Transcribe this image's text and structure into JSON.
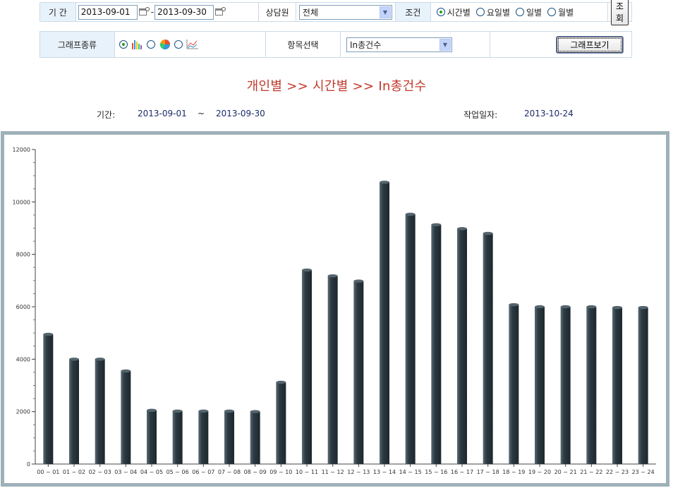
{
  "filter": {
    "period_label": "기 간",
    "start_date": "2013-09-01",
    "date_sep": "-",
    "end_date": "2013-09-30",
    "agent_label": "상담원",
    "agent_value": "전체",
    "condition_label": "조건",
    "conditions": [
      {
        "label": "시간별",
        "checked": true
      },
      {
        "label": "요일별",
        "checked": false
      },
      {
        "label": "일별",
        "checked": false
      },
      {
        "label": "월별",
        "checked": false
      }
    ],
    "search_button": "조회"
  },
  "graph_options": {
    "type_label": "그래프종류",
    "types": [
      {
        "icon": "bar-chart-icon",
        "checked": true
      },
      {
        "icon": "pie-chart-icon",
        "checked": false
      },
      {
        "icon": "line-chart-icon",
        "checked": false
      }
    ],
    "item_label": "항목선택",
    "item_value": "In총건수",
    "view_button": "그래프보기"
  },
  "report": {
    "heading": "개인별 >> 시간별 >> In총건수",
    "period_label": "기간:",
    "period_start": "2013-09-01",
    "period_tilde": "~",
    "period_end": "2013-09-30",
    "work_date_label": "작업일자:",
    "work_date": "2013-10-24"
  },
  "colors": {
    "bar": "#2c3a42",
    "bar_highlight": "#5b6b74",
    "title": "#c0392b",
    "frame": "#9eb0b8"
  },
  "chart_data": {
    "type": "bar",
    "title": "개인별 >> 시간별 >> In총건수",
    "xlabel": "",
    "ylabel": "",
    "ylim": [
      0,
      12000
    ],
    "yticks": [
      0,
      2000,
      4000,
      6000,
      8000,
      10000,
      12000
    ],
    "grid": false,
    "categories": [
      "00 ~ 01",
      "01 ~ 02",
      "02 ~ 03",
      "03 ~ 04",
      "04 ~ 05",
      "05 ~ 06",
      "06 ~ 07",
      "07 ~ 08",
      "08 ~ 09",
      "09 ~ 10",
      "10 ~ 11",
      "11 ~ 12",
      "12 ~ 13",
      "13 ~ 14",
      "14 ~ 15",
      "15 ~ 16",
      "16 ~ 17",
      "17 ~ 18",
      "18 ~ 19",
      "19 ~ 20",
      "20 ~ 21",
      "21 ~ 22",
      "22 ~ 23",
      "23 ~ 24"
    ],
    "values": [
      4950,
      4000,
      4000,
      3550,
      2050,
      2020,
      2020,
      2020,
      2000,
      3120,
      7400,
      7180,
      6980,
      10750,
      9530,
      9130,
      8980,
      8800,
      6080,
      6000,
      6000,
      6000,
      5970,
      5970
    ]
  }
}
